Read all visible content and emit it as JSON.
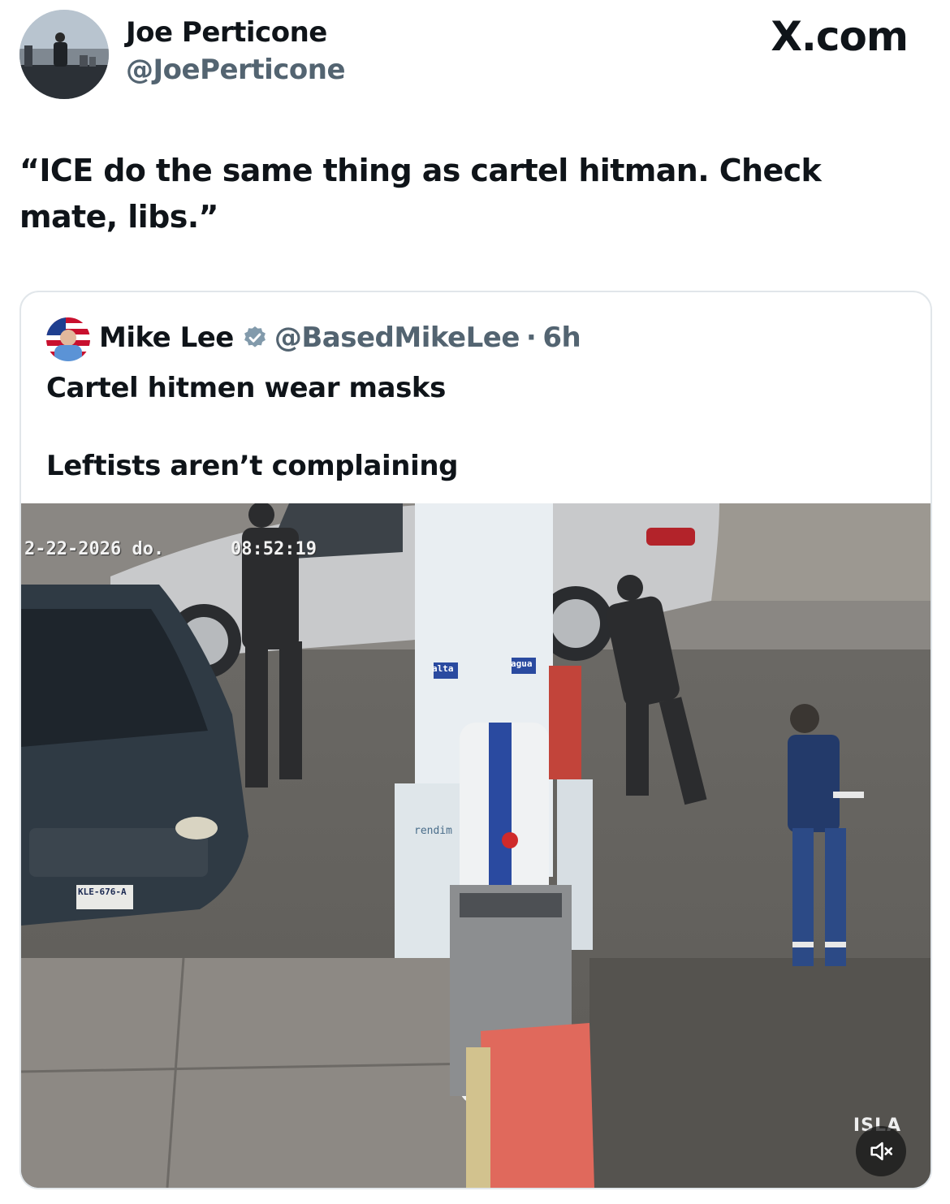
{
  "tweet": {
    "author_name": "Joe Perticone",
    "author_handle": "@JoePerticone",
    "site": "X.com",
    "text": "“ICE do the same thing as cartel hitman. Check mate, libs.”"
  },
  "quote": {
    "author_name": "Mike Lee",
    "author_handle": "@BasedMikeLee",
    "separator": "·",
    "time_ago": "6h",
    "line1": "Cartel hitmen wear masks",
    "line2": "Leftists aren’t complaining",
    "video": {
      "timestamp_date": "2-22-2026 do.",
      "timestamp_time": "08:52:19",
      "watermark": "ISLA",
      "plate": "KLE-676-A",
      "pump_labels": [
        "alta",
        "agua"
      ],
      "pump_sign_text": "rendim",
      "muted": true
    }
  },
  "colors": {
    "verified_badge": "#829aab",
    "handle_gray": "#536471",
    "card_border": "#e1e6ea"
  },
  "icons": [
    "verified-badge-icon",
    "speaker-muted-icon"
  ]
}
